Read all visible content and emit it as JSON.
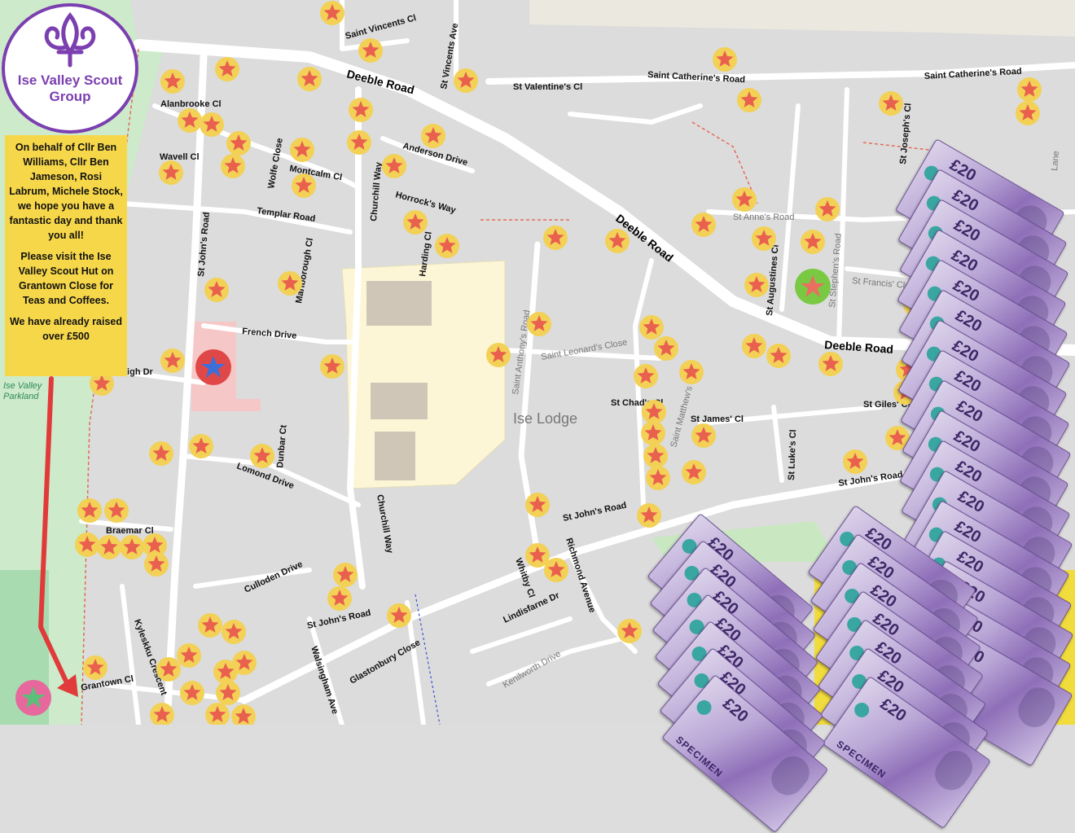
{
  "organisation": {
    "name": "Ise Valley Scout Group",
    "colour": "#7b3fb0"
  },
  "notice": {
    "paragraphs": [
      "On behalf of Cllr Ben Williams, Cllr Ben Jameson, Rosi Labrum, Michele Stock, we hope you have a fantastic day and thank you all!",
      "Please visit the Ise Valley Scout Hut on Grantown Close for Teas and Coffees.",
      "We have already raised over £500"
    ],
    "background": "#f7d74a"
  },
  "map": {
    "area_label": "Ise Lodge",
    "park_label": "Ise Valley Parkland",
    "major_roads": [
      "Deeble Road",
      "Deeble Road",
      "Deeble Road"
    ],
    "streets": [
      "Saint Vincents Cl",
      "St Vincents Ave",
      "St Valentine's Cl",
      "Saint Catherine's Road",
      "Saint Catherine's Road",
      "Alanbrooke Cl",
      "Wavell Cl",
      "Wolfe Close",
      "Montcalm Cl",
      "Anderson Drive",
      "Churchill Way",
      "Horrock's Way",
      "Templar Road",
      "Harding Cl",
      "Marlborough Cl",
      "St John's Road",
      "French Drive",
      "Haigh Dr",
      "Dunbar Ct",
      "Lomond Drive",
      "Braemar Cl",
      "Culloden Drive",
      "Kyleskku Crescent",
      "Grantown Cl",
      "Walsingham Ave",
      "Glastonbury Close",
      "St John's Road",
      "Lindisfarne Dr",
      "Whitby Cl",
      "Richmond Avenue",
      "Kenilworth Drive",
      "St John's Road",
      "Saint Anthony's Road",
      "Saint Leonard's Close",
      "St Chad's Cl",
      "Saint Matthew's Road",
      "St James' Cl",
      "St Luke's Cl",
      "St John's Road",
      "St Giles' Cl",
      "St Anne's Road",
      "St Augustines Cl",
      "St Stephen's Road",
      "St Francis' Close",
      "St Joseph's Cl",
      "Churchill Way",
      "Lane"
    ],
    "marker_legend": {
      "sale": "#f2d156",
      "scout_hut": "#e7689c",
      "school": "#e04848",
      "church": "#7ac943"
    }
  },
  "banknotes": {
    "denomination": "£20",
    "specimen_label": "SPECIMEN"
  }
}
